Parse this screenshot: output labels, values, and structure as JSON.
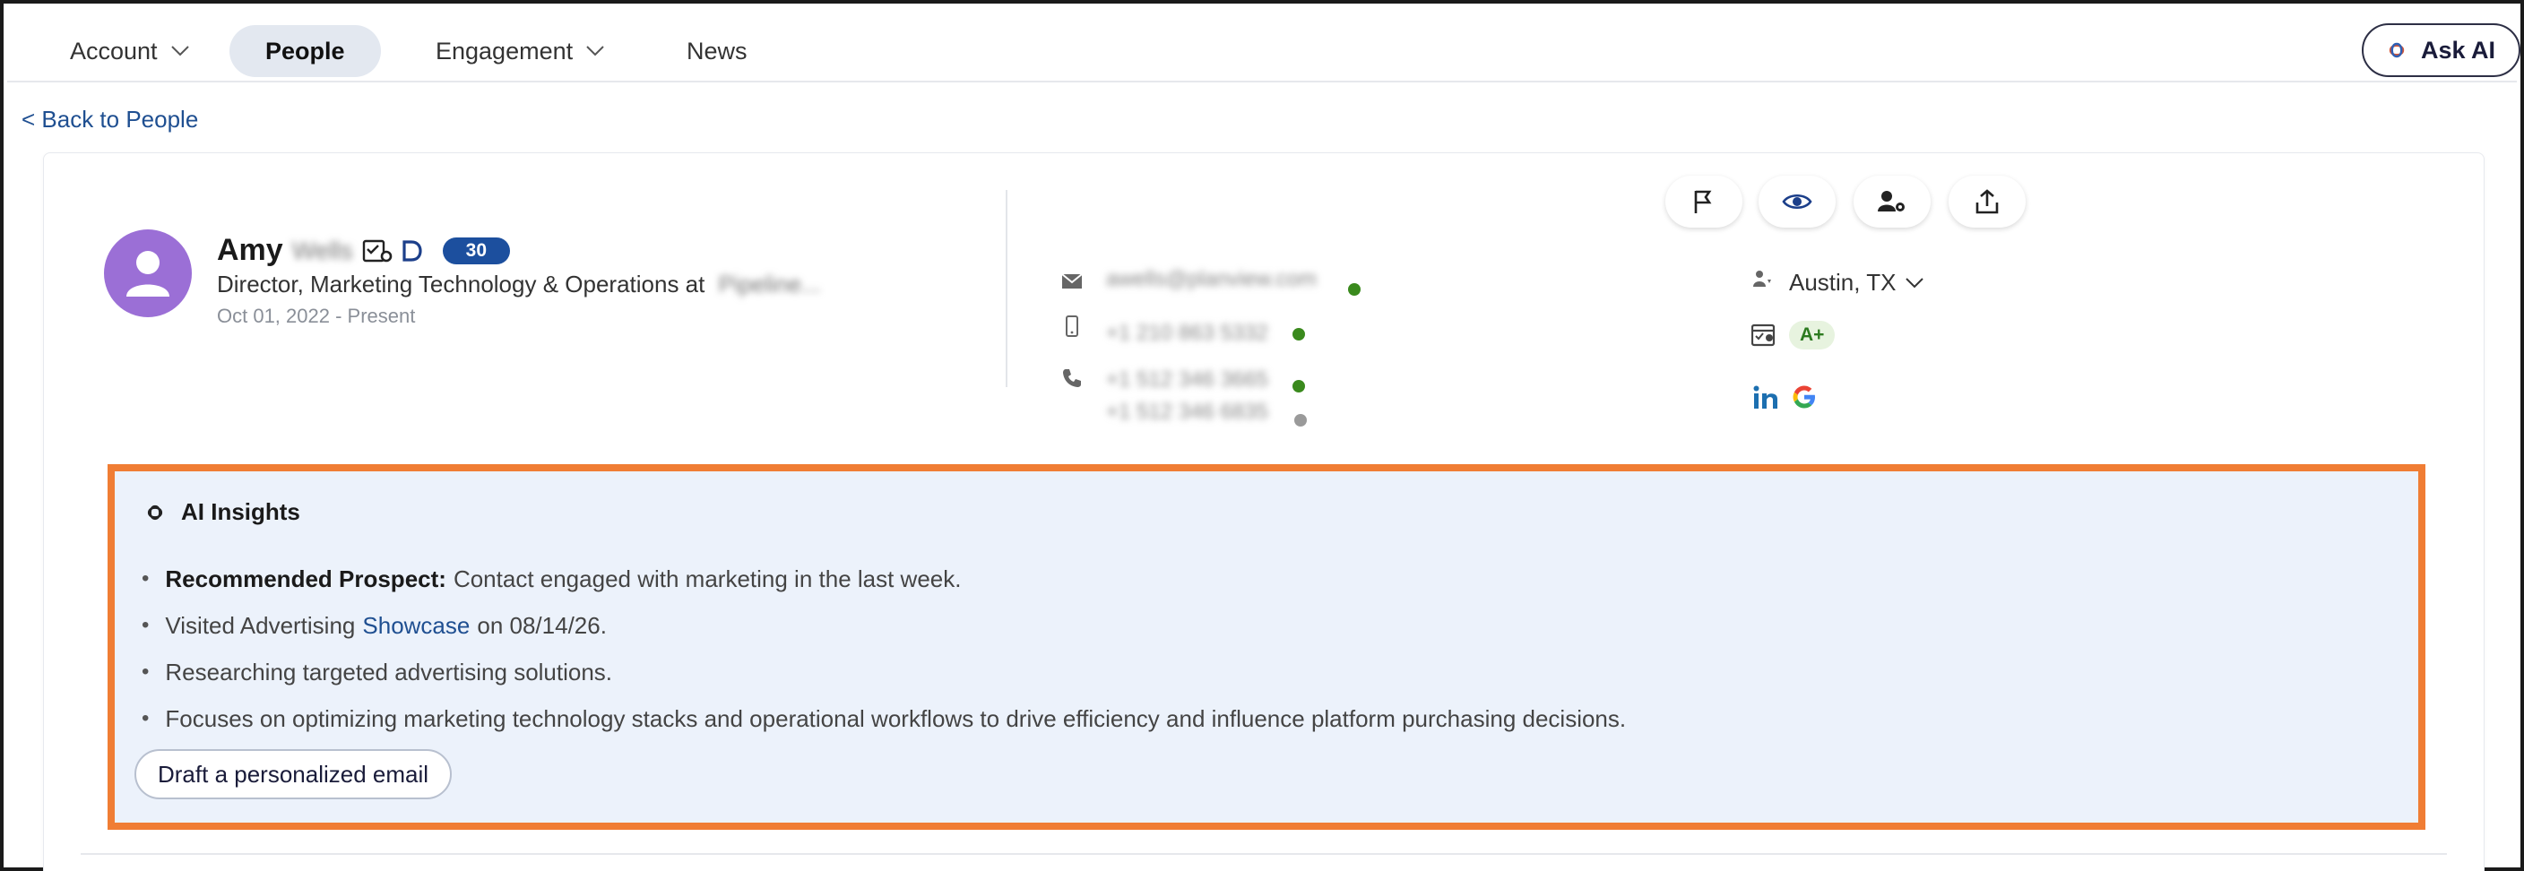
{
  "nav": {
    "items": [
      {
        "label": "Account",
        "has_dropdown": true,
        "active": false
      },
      {
        "label": "People",
        "has_dropdown": false,
        "active": true
      },
      {
        "label": "Engagement",
        "has_dropdown": true,
        "active": false
      },
      {
        "label": "News",
        "has_dropdown": false,
        "active": false
      }
    ],
    "ask_ai_label": "Ask AI"
  },
  "back_link": "< Back to People",
  "profile": {
    "first_name": "Amy",
    "last_name_redacted": "Wells",
    "score": "30",
    "title": "Director, Marketing Technology & Operations at",
    "company_redacted": "Pipeline...",
    "date_range": "Oct 01, 2022 - Present",
    "avatar_color": "#9b6fd6"
  },
  "contact": {
    "email_redacted": "awells@planview.com",
    "mobile_redacted": "+1 210 863 5332",
    "phone_redacted_1": "+1 512 346 3665",
    "phone_redacted_2": "+1 512 346 6835",
    "location": "Austin, TX",
    "grade": "A+"
  },
  "actions": [
    "flag-icon",
    "eye-icon",
    "user-settings-icon",
    "share-icon"
  ],
  "ai_insights": {
    "title": "AI Insights",
    "items": [
      {
        "bold": "Recommended Prospect:",
        "text": "Contact engaged with marketing in the last week."
      },
      {
        "pre": "Visited Advertising",
        "link": "Showcase",
        "post": "on 08/14/26."
      },
      {
        "text": "Researching targeted advertising solutions."
      },
      {
        "text": "Focuses on optimizing marketing technology stacks and operational workflows to drive efficiency and influence platform purchasing decisions."
      }
    ],
    "draft_button": "Draft a personalized email",
    "border_color": "#f07d34",
    "background": "#ecf2fb"
  }
}
